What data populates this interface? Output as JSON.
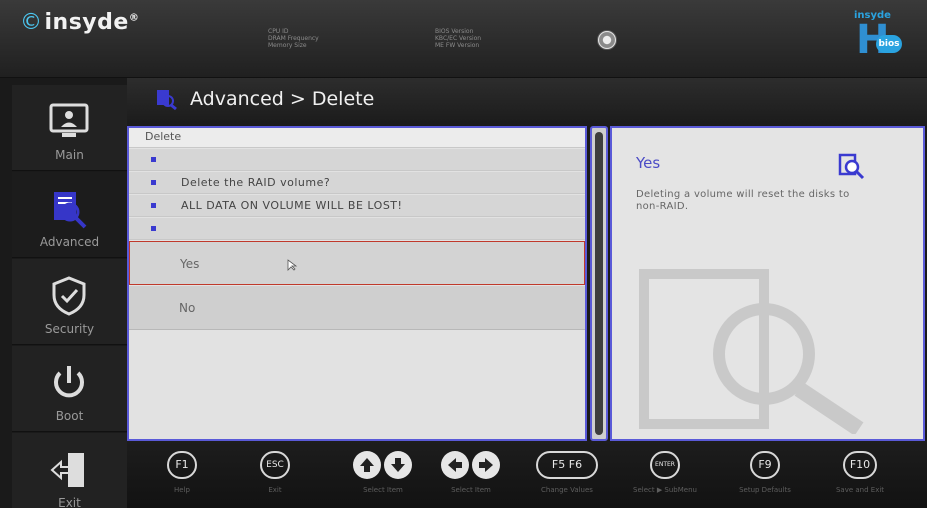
{
  "header": {
    "logo_text": "insyde",
    "logo_registered": "®",
    "info_left": [
      "CPU ID",
      "DRAM Frequency",
      "Memory Size"
    ],
    "info_right": [
      "BIOS Version",
      "KBC/EC Version",
      "ME FW Version"
    ],
    "badge_brand": "insyde",
    "badge_letter": "H",
    "badge_bios": "bios"
  },
  "sidebar": {
    "items": [
      {
        "label": "Main",
        "icon": "monitor-icon"
      },
      {
        "label": "Advanced",
        "icon": "advanced-icon",
        "active": true
      },
      {
        "label": "Security",
        "icon": "shield-icon"
      },
      {
        "label": "Boot",
        "icon": "power-icon"
      },
      {
        "label": "Exit",
        "icon": "exit-door-icon"
      }
    ]
  },
  "title": "Advanced > Delete",
  "panel": {
    "header": "Delete",
    "rows": [
      "",
      "Delete the RAID volume?",
      "ALL DATA ON VOLUME WILL BE LOST!",
      ""
    ],
    "options": [
      "Yes",
      "No"
    ],
    "selected": "Yes"
  },
  "help": {
    "title": "Yes",
    "description": "Deleting a volume will reset the disks to non-RAID."
  },
  "footer": {
    "keys": [
      {
        "key": "F1",
        "label": "Help"
      },
      {
        "key": "ESC",
        "label": "Exit"
      },
      {
        "key": "↑↓",
        "label": "Select Item"
      },
      {
        "key": "←→",
        "label": "Select Item"
      },
      {
        "key": "F5 F6",
        "label": "Change Values"
      },
      {
        "key": "ENTER",
        "label": "Select ▶ SubMenu"
      },
      {
        "key": "F9",
        "label": "Setup Defaults"
      },
      {
        "key": "F10",
        "label": "Save and Exit"
      }
    ]
  },
  "colors": {
    "accent": "#5a5ad8",
    "highlight_border": "#c0392b",
    "help_title": "#4c4cc6"
  }
}
